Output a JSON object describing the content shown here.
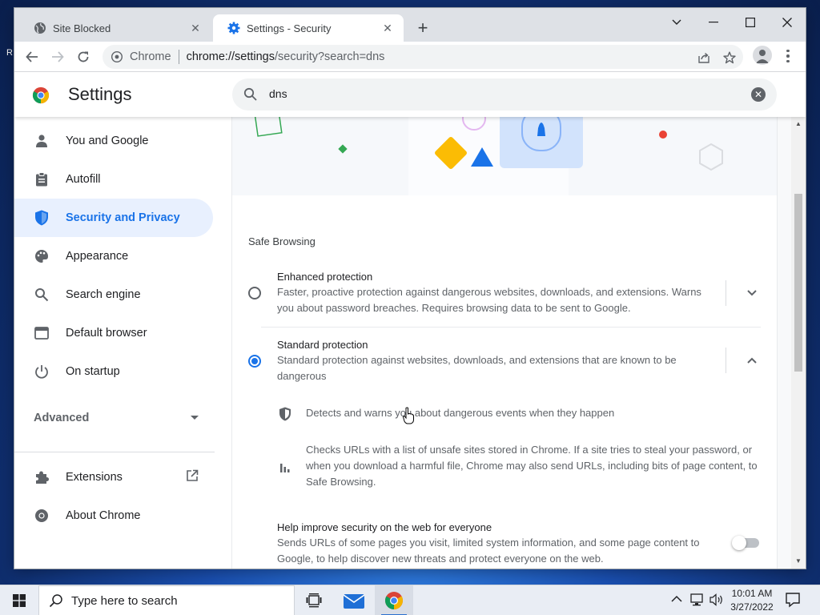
{
  "desktop": {
    "edge_text": "R"
  },
  "tabs": [
    {
      "title": "Site Blocked",
      "icon": "globe-icon",
      "active": false
    },
    {
      "title": "Settings - Security",
      "icon": "gear-icon",
      "active": true
    }
  ],
  "toolbar": {
    "scheme_label": "Chrome",
    "url_host": "chrome://settings",
    "url_path": "/security?search=dns"
  },
  "settings": {
    "title": "Settings",
    "search_value": "dns"
  },
  "sidebar": {
    "items": [
      {
        "label": "You and Google",
        "icon": "person-icon"
      },
      {
        "label": "Autofill",
        "icon": "clipboard-icon"
      },
      {
        "label": "Security and Privacy",
        "icon": "shield-icon",
        "selected": true
      },
      {
        "label": "Appearance",
        "icon": "palette-icon"
      },
      {
        "label": "Search engine",
        "icon": "search-icon"
      },
      {
        "label": "Default browser",
        "icon": "browser-icon"
      },
      {
        "label": "On startup",
        "icon": "power-icon"
      }
    ],
    "advanced_label": "Advanced",
    "extensions_label": "Extensions",
    "about_label": "About Chrome"
  },
  "main": {
    "section_title": "Safe Browsing",
    "enhanced": {
      "title": "Enhanced protection",
      "desc": "Faster, proactive protection against dangerous websites, downloads, and extensions. Warns you about password breaches. Requires browsing data to be sent to Google.",
      "selected": false
    },
    "standard": {
      "title": "Standard protection",
      "desc": "Standard protection against websites, downloads, and extensions that are known to be dangerous",
      "selected": true
    },
    "bullet1": "Detects and warns you about dangerous events when they happen",
    "bullet2": "Checks URLs with a list of unsafe sites stored in Chrome. If a site tries to steal your password, or when you download a harmful file, Chrome may also send URLs, including bits of page content, to Safe Browsing.",
    "help": {
      "title": "Help improve security on the web for everyone",
      "desc": "Sends URLs of some pages you visit, limited system information, and some page content to Google, to help discover new threats and protect everyone on the web.",
      "enabled": false
    }
  },
  "taskbar": {
    "search_placeholder": "Type here to search",
    "time": "10:01 AM",
    "date": "3/27/2022"
  },
  "colors": {
    "accent": "#1a73e8",
    "selected_bg": "#e8f0fe"
  }
}
